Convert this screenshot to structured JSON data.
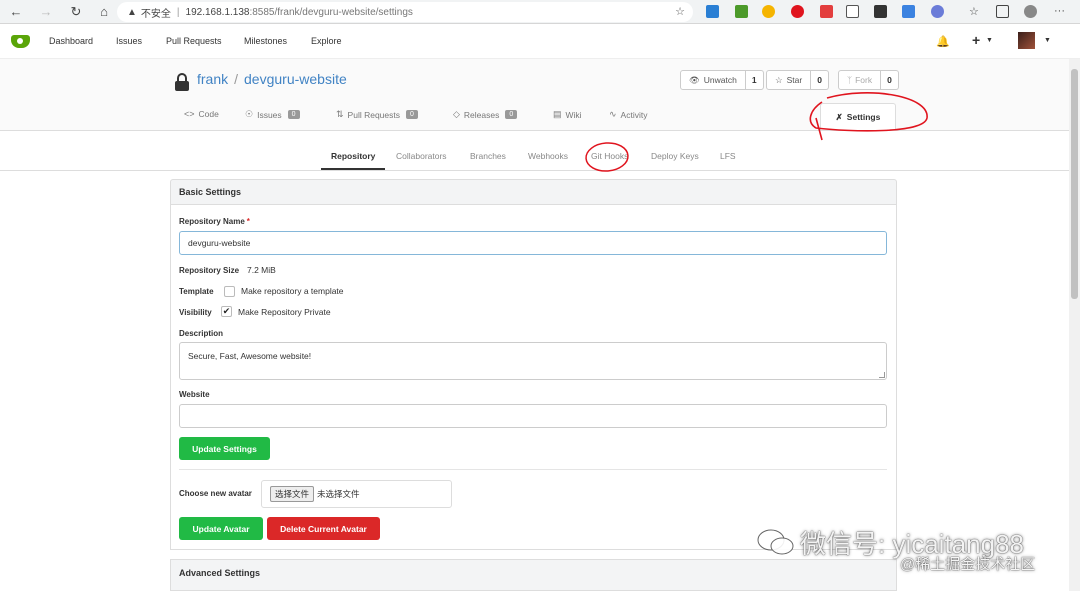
{
  "browser": {
    "security": "不安全",
    "url_host": "192.168.1.138",
    "url_rest": ":8585/frank/devguru-website/settings"
  },
  "topnav": {
    "links": [
      "Dashboard",
      "Issues",
      "Pull Requests",
      "Milestones",
      "Explore"
    ],
    "plus": "+"
  },
  "repo": {
    "owner": "frank",
    "name": "devguru-website",
    "watch_label": "Unwatch",
    "watch_count": "1",
    "star_label": "Star",
    "star_count": "0",
    "fork_label": "Fork",
    "fork_count": "0",
    "tabs": {
      "code": "Code",
      "issues": "Issues",
      "issues_count": "0",
      "pulls": "Pull Requests",
      "pulls_count": "0",
      "releases": "Releases",
      "releases_count": "0",
      "wiki": "Wiki",
      "activity": "Activity",
      "settings": "Settings"
    }
  },
  "settings_tabs": [
    "Repository",
    "Collaborators",
    "Branches",
    "Webhooks",
    "Git Hooks",
    "Deploy Keys",
    "LFS"
  ],
  "basic": {
    "heading": "Basic Settings",
    "name_label": "Repository Name",
    "required_mark": "*",
    "name_value": "devguru-website",
    "size_label": "Repository Size",
    "size_value": "7.2 MiB",
    "template_label": "Template",
    "template_text": "Make repository a template",
    "template_checked": false,
    "visibility_label": "Visibility",
    "visibility_text": "Make Repository Private",
    "visibility_checked": true,
    "description_label": "Description",
    "description_value": "Secure, Fast, Awesome website!",
    "website_label": "Website",
    "website_value": "",
    "update_button": "Update Settings",
    "avatar_label": "Choose new avatar",
    "file_button": "选择文件",
    "file_status": "未选择文件",
    "update_avatar": "Update Avatar",
    "delete_avatar": "Delete Current Avatar"
  },
  "advanced": {
    "heading": "Advanced Settings"
  },
  "watermark": {
    "line1": "微信号: yicaitang88",
    "line2": "@稀土掘金技术社区"
  },
  "colors": {
    "link": "#4183c4",
    "green": "#21ba45",
    "red": "#db2828",
    "annotation": "#e0141e"
  }
}
